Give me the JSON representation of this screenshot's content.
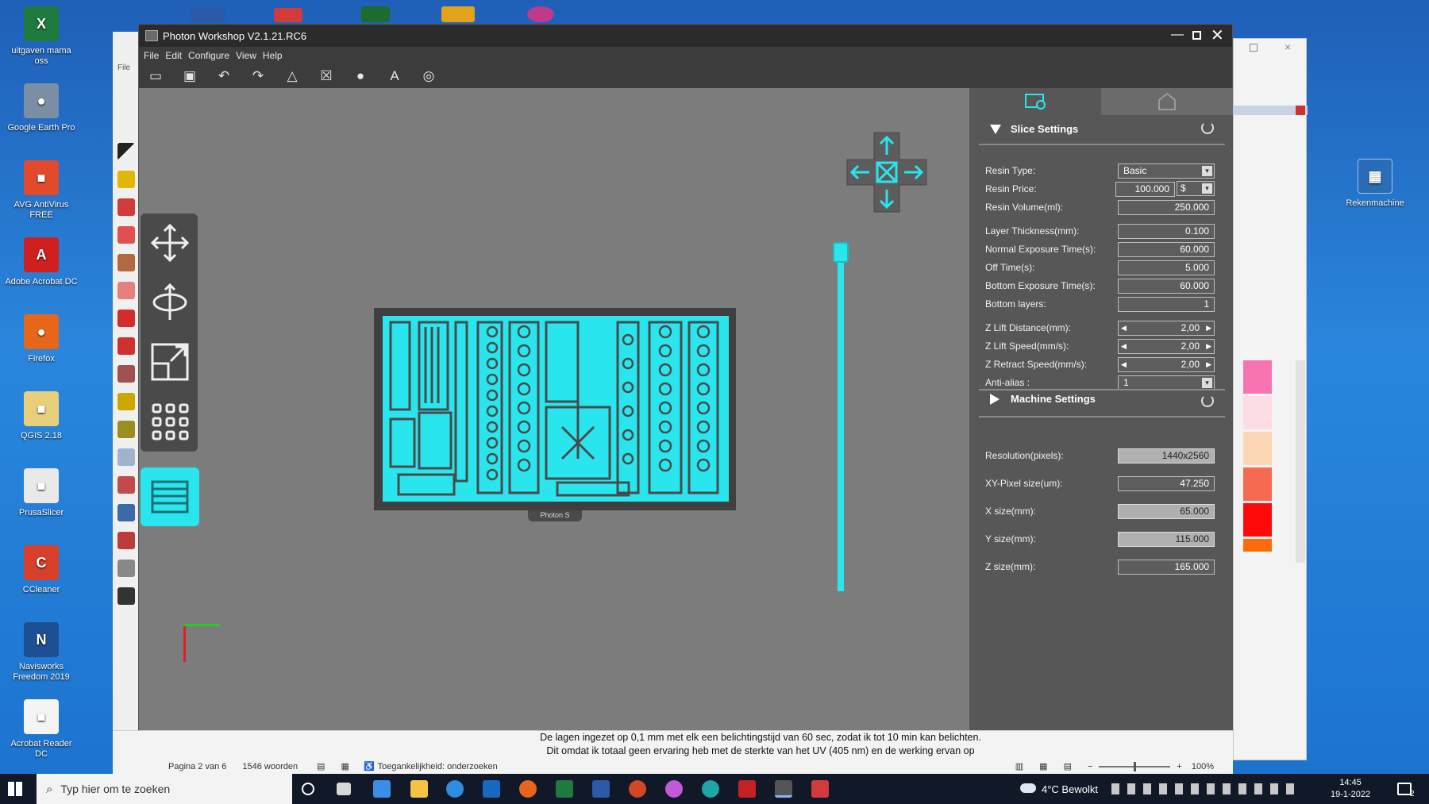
{
  "desktop": {
    "icons": [
      {
        "label": "uitgaven mama oss",
        "color": "#1e7a3f",
        "glyph": "X"
      },
      {
        "label": "Google Earth Pro",
        "color": "#7a8fa6",
        "glyph": "●"
      },
      {
        "label": "AVG AntiVirus FREE",
        "color": "#e24a2c",
        "glyph": "■"
      },
      {
        "label": "Adobe Acrobat DC",
        "color": "#d01f1f",
        "glyph": "A"
      },
      {
        "label": "Firefox",
        "color": "#e8661a",
        "glyph": "●"
      },
      {
        "label": "QGIS 2.18",
        "color": "#e8d07a",
        "glyph": "■"
      },
      {
        "label": "PrusaSlicer",
        "color": "#e9e9e9",
        "glyph": "■"
      },
      {
        "label": "CCleaner",
        "color": "#d7402a",
        "glyph": "C"
      },
      {
        "label": "Navisworks Freedom 2019",
        "color": "#1d4f94",
        "glyph": "N"
      },
      {
        "label": "Acrobat Reader DC",
        "color": "#f4f4f4",
        "glyph": "■"
      }
    ],
    "right_icon": {
      "label": "Rekenmachine",
      "glyph": "▦"
    }
  },
  "app": {
    "title": "Photon Workshop V2.1.21.RC6",
    "menu": [
      "File",
      "Edit",
      "Configure",
      "View",
      "Help"
    ],
    "toolbar_icons": [
      "open-icon",
      "save-icon",
      "undo-icon",
      "redo-icon",
      "mirror-icon",
      "hollow-icon",
      "mask-icon",
      "text-icon",
      "model-icon"
    ],
    "build_plate_label": "Photon S",
    "panel": {
      "slice_settings_title": "Slice Settings",
      "machine_settings_title": "Machine Settings",
      "rows": [
        {
          "label": "Resin Type:",
          "value": "Basic",
          "kind": "select"
        },
        {
          "label": "Resin Price:",
          "value": "100.000",
          "unit": "$",
          "kind": "price"
        },
        {
          "label": "Resin Volume(ml):",
          "value": "250.000",
          "kind": "input"
        },
        {
          "label": "Layer Thickness(mm):",
          "value": "0.100",
          "kind": "input"
        },
        {
          "label": "Normal Exposure Time(s):",
          "value": "60.000",
          "kind": "input"
        },
        {
          "label": "Off Time(s):",
          "value": "5.000",
          "kind": "input"
        },
        {
          "label": "Bottom Exposure Time(s):",
          "value": "60.000",
          "kind": "input"
        },
        {
          "label": "Bottom layers:",
          "value": "1",
          "kind": "input"
        },
        {
          "label": "Z Lift Distance(mm):",
          "value": "2,00",
          "kind": "spin"
        },
        {
          "label": "Z Lift Speed(mm/s):",
          "value": "2,00",
          "kind": "spin"
        },
        {
          "label": "Z Retract Speed(mm/s):",
          "value": "2,00",
          "kind": "spin"
        },
        {
          "label": "Anti-alias :",
          "value": "1",
          "kind": "select-left"
        }
      ],
      "machine_rows": [
        {
          "label": "Resolution(pixels):",
          "value": "1440x2560",
          "grey": true
        },
        {
          "label": "XY-Pixel size(um):",
          "value": "47.250",
          "grey": false
        },
        {
          "label": "X size(mm):",
          "value": "65.000",
          "grey": true
        },
        {
          "label": "Y size(mm):",
          "value": "115.000",
          "grey": true
        },
        {
          "label": "Z size(mm):",
          "value": "165.000",
          "grey": false
        }
      ]
    }
  },
  "word": {
    "doc_text_1": "De lagen ingezet op 0,1 mm met elk een belichtingstijd van 60 sec, zodat ik tot 10 min kan belichten.",
    "doc_text_2": "Dit omdat ik totaal geen ervaring heb met de sterkte van het UV (405 nm) en de werking ervan op",
    "status_page": "Pagina 2 van 6",
    "status_words": "1546 woorden",
    "status_access": "Toegankelijkheid: onderzoeken",
    "zoom": "100%",
    "left_menu_label": "File"
  },
  "taskbar": {
    "search_placeholder": "Typ hier om te zoeken",
    "weather": "4°C  Bewolkt",
    "time": "14:45",
    "date": "19-1-2022",
    "notification_count": "2",
    "colors": {
      "accent": "#29e6ee",
      "panel": "#575757",
      "viewport": "#7c7c7c"
    }
  }
}
